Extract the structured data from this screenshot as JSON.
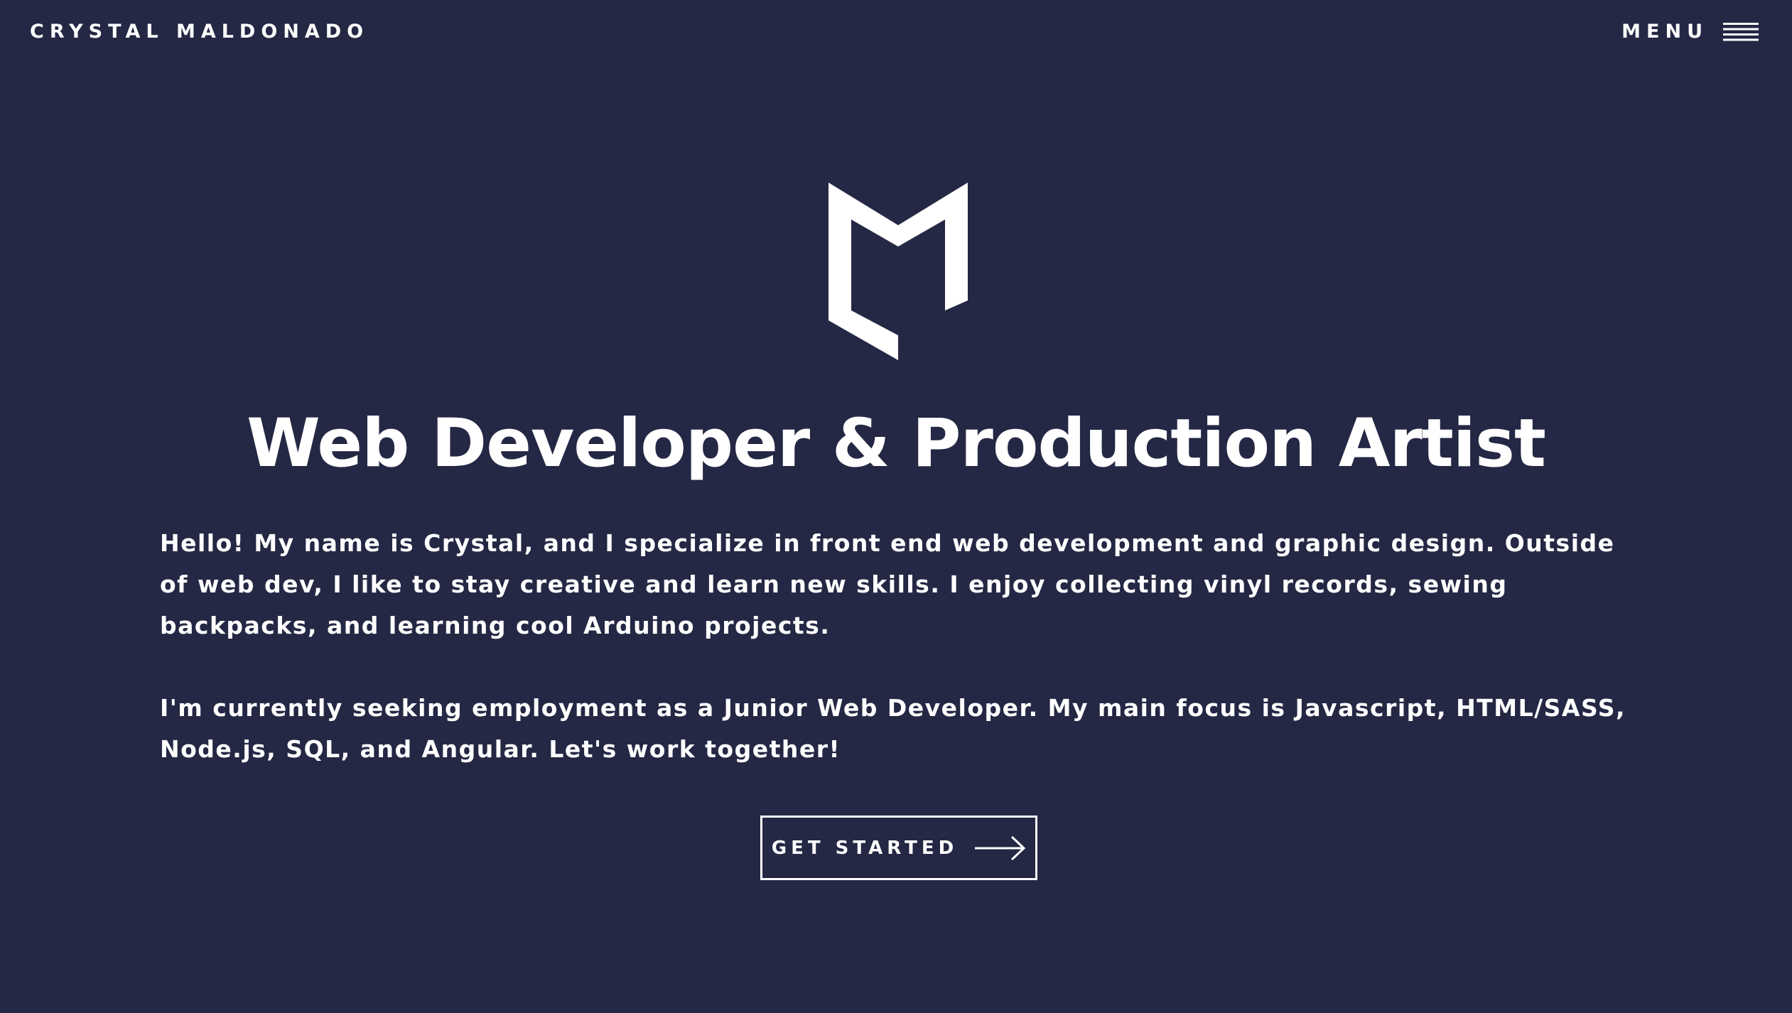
{
  "header": {
    "brand": "CRYSTAL MALDONADO",
    "menu_label": "MENU",
    "menu_icon": "hamburger-icon"
  },
  "hero": {
    "logo_icon": "m-monogram-logo",
    "headline": "Web Developer & Production Artist",
    "paragraphs": [
      "Hello! My name is Crystal, and I specialize in front end web development and graphic design. Outside of web dev, I like to stay creative and learn new skills. I enjoy collecting vinyl records, sewing backpacks, and learning cool Arduino projects.",
      "I'm currently seeking employment as a Junior Web Developer. My main focus is Javascript, HTML/SASS, Node.js, SQL, and Angular. Let's work together!"
    ],
    "cta_label": "GET STARTED",
    "cta_icon": "arrow-right-icon"
  },
  "colors": {
    "background": "#242844",
    "foreground": "#ffffff"
  }
}
